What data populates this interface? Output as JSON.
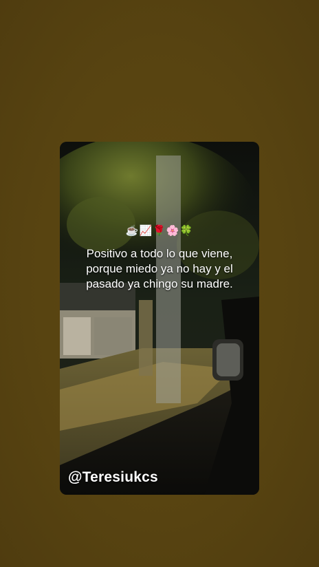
{
  "story": {
    "emojis": "☕📈🌹🌸🍀",
    "caption": "Positivo a todo lo que viene, porque miedo ya no hay y el pasado ya chingo su madre.",
    "watermark": "@Teresiukcs"
  },
  "colors": {
    "background": "#574311",
    "caption_text": "#ffffff",
    "watermark_text": "#ffffff"
  }
}
